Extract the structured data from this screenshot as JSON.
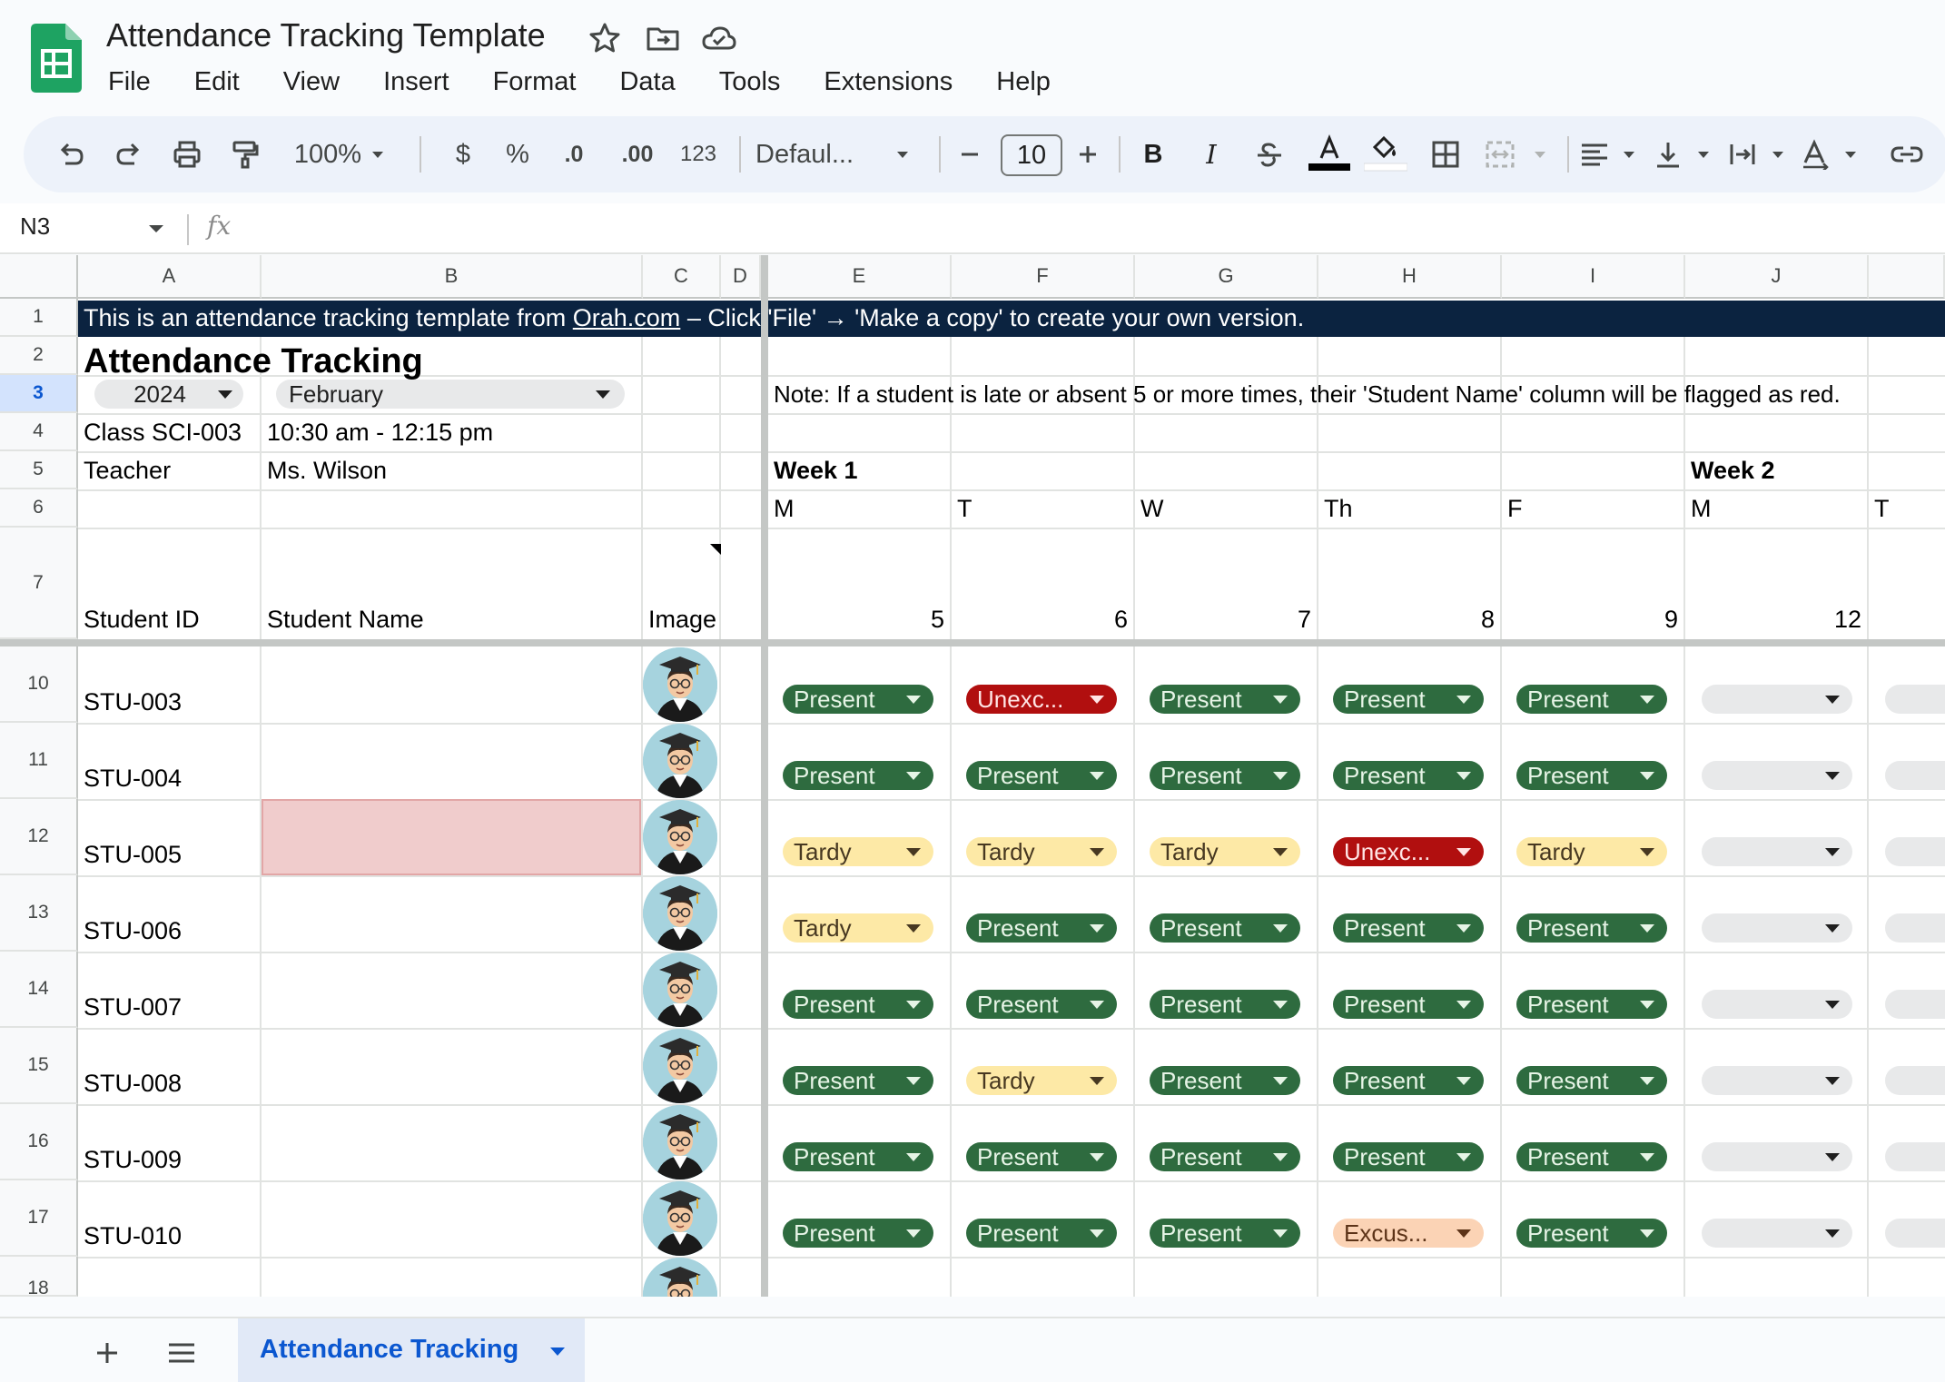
{
  "app": {
    "title": "Attendance Tracking Template",
    "menu": [
      "File",
      "Edit",
      "View",
      "Insert",
      "Format",
      "Data",
      "Tools",
      "Extensions",
      "Help"
    ]
  },
  "toolbar": {
    "zoom": "100%",
    "currency": "$",
    "percent": "%",
    "dec_decrease": ".0",
    "dec_increase": ".00",
    "number_format": "123",
    "font": "Defaul...",
    "font_size": "10",
    "bold": "B",
    "italic": "I"
  },
  "formula_bar": {
    "name_box": "N3",
    "fx": "fx"
  },
  "columns": [
    "A",
    "B",
    "C",
    "D",
    "E",
    "F",
    "G",
    "H",
    "I",
    "J"
  ],
  "rows_header": [
    "1",
    "2",
    "3",
    "4",
    "5",
    "6",
    "7",
    "10",
    "11",
    "12",
    "13",
    "14",
    "15",
    "16",
    "17",
    "18"
  ],
  "sheet": {
    "banner_prefix": "This is an attendance tracking template from ",
    "banner_link": "Orah.com",
    "banner_suffix": " – Click 'File' → 'Make a copy' to create your own version.",
    "heading": "Attendance Tracking",
    "year": "2024",
    "month": "February",
    "note": "Note: If a student is late or absent 5 or more times, their 'Student Name' column will be flagged as red.",
    "class_label": "Class SCI-003",
    "class_time": "10:30 am - 12:15 pm",
    "teacher_label": "Teacher",
    "teacher_name": "Ms. Wilson",
    "week1": "Week 1",
    "week2": "Week 2",
    "days": [
      "M",
      "T",
      "W",
      "Th",
      "F",
      "M",
      "T"
    ],
    "dates": [
      "5",
      "6",
      "7",
      "8",
      "9",
      "12"
    ],
    "col_headers": {
      "student_id": "Student ID",
      "student_name": "Student Name",
      "image": "Image"
    }
  },
  "students": [
    {
      "row": "10",
      "id": "STU-003",
      "flagged": false,
      "status": [
        "Present",
        "Unexc...",
        "Present",
        "Present",
        "Present"
      ],
      "kind": [
        "present",
        "unexcused",
        "present",
        "present",
        "present"
      ]
    },
    {
      "row": "11",
      "id": "STU-004",
      "flagged": false,
      "status": [
        "Present",
        "Present",
        "Present",
        "Present",
        "Present"
      ],
      "kind": [
        "present",
        "present",
        "present",
        "present",
        "present"
      ]
    },
    {
      "row": "12",
      "id": "STU-005",
      "flagged": true,
      "status": [
        "Tardy",
        "Tardy",
        "Tardy",
        "Unexc...",
        "Tardy"
      ],
      "kind": [
        "tardy",
        "tardy",
        "tardy",
        "unexcused",
        "tardy"
      ]
    },
    {
      "row": "13",
      "id": "STU-006",
      "flagged": false,
      "status": [
        "Tardy",
        "Present",
        "Present",
        "Present",
        "Present"
      ],
      "kind": [
        "tardy",
        "present",
        "present",
        "present",
        "present"
      ]
    },
    {
      "row": "14",
      "id": "STU-007",
      "flagged": false,
      "status": [
        "Present",
        "Present",
        "Present",
        "Present",
        "Present"
      ],
      "kind": [
        "present",
        "present",
        "present",
        "present",
        "present"
      ]
    },
    {
      "row": "15",
      "id": "STU-008",
      "flagged": false,
      "status": [
        "Present",
        "Tardy",
        "Present",
        "Present",
        "Present"
      ],
      "kind": [
        "present",
        "tardy",
        "present",
        "present",
        "present"
      ]
    },
    {
      "row": "16",
      "id": "STU-009",
      "flagged": false,
      "status": [
        "Present",
        "Present",
        "Present",
        "Present",
        "Present"
      ],
      "kind": [
        "present",
        "present",
        "present",
        "present",
        "present"
      ]
    },
    {
      "row": "17",
      "id": "STU-010",
      "flagged": false,
      "status": [
        "Present",
        "Present",
        "Present",
        "Excus...",
        "Present"
      ],
      "kind": [
        "present",
        "present",
        "present",
        "excused",
        "present"
      ]
    }
  ],
  "tabs": {
    "active": "Attendance Tracking"
  },
  "colors": {
    "present": "#2e6b3f",
    "tardy": "#fde9a6",
    "unexcused": "#b10f0f",
    "excused": "#fbd3b5",
    "flagged": "#f0cccc",
    "banner": "#0b2340"
  }
}
